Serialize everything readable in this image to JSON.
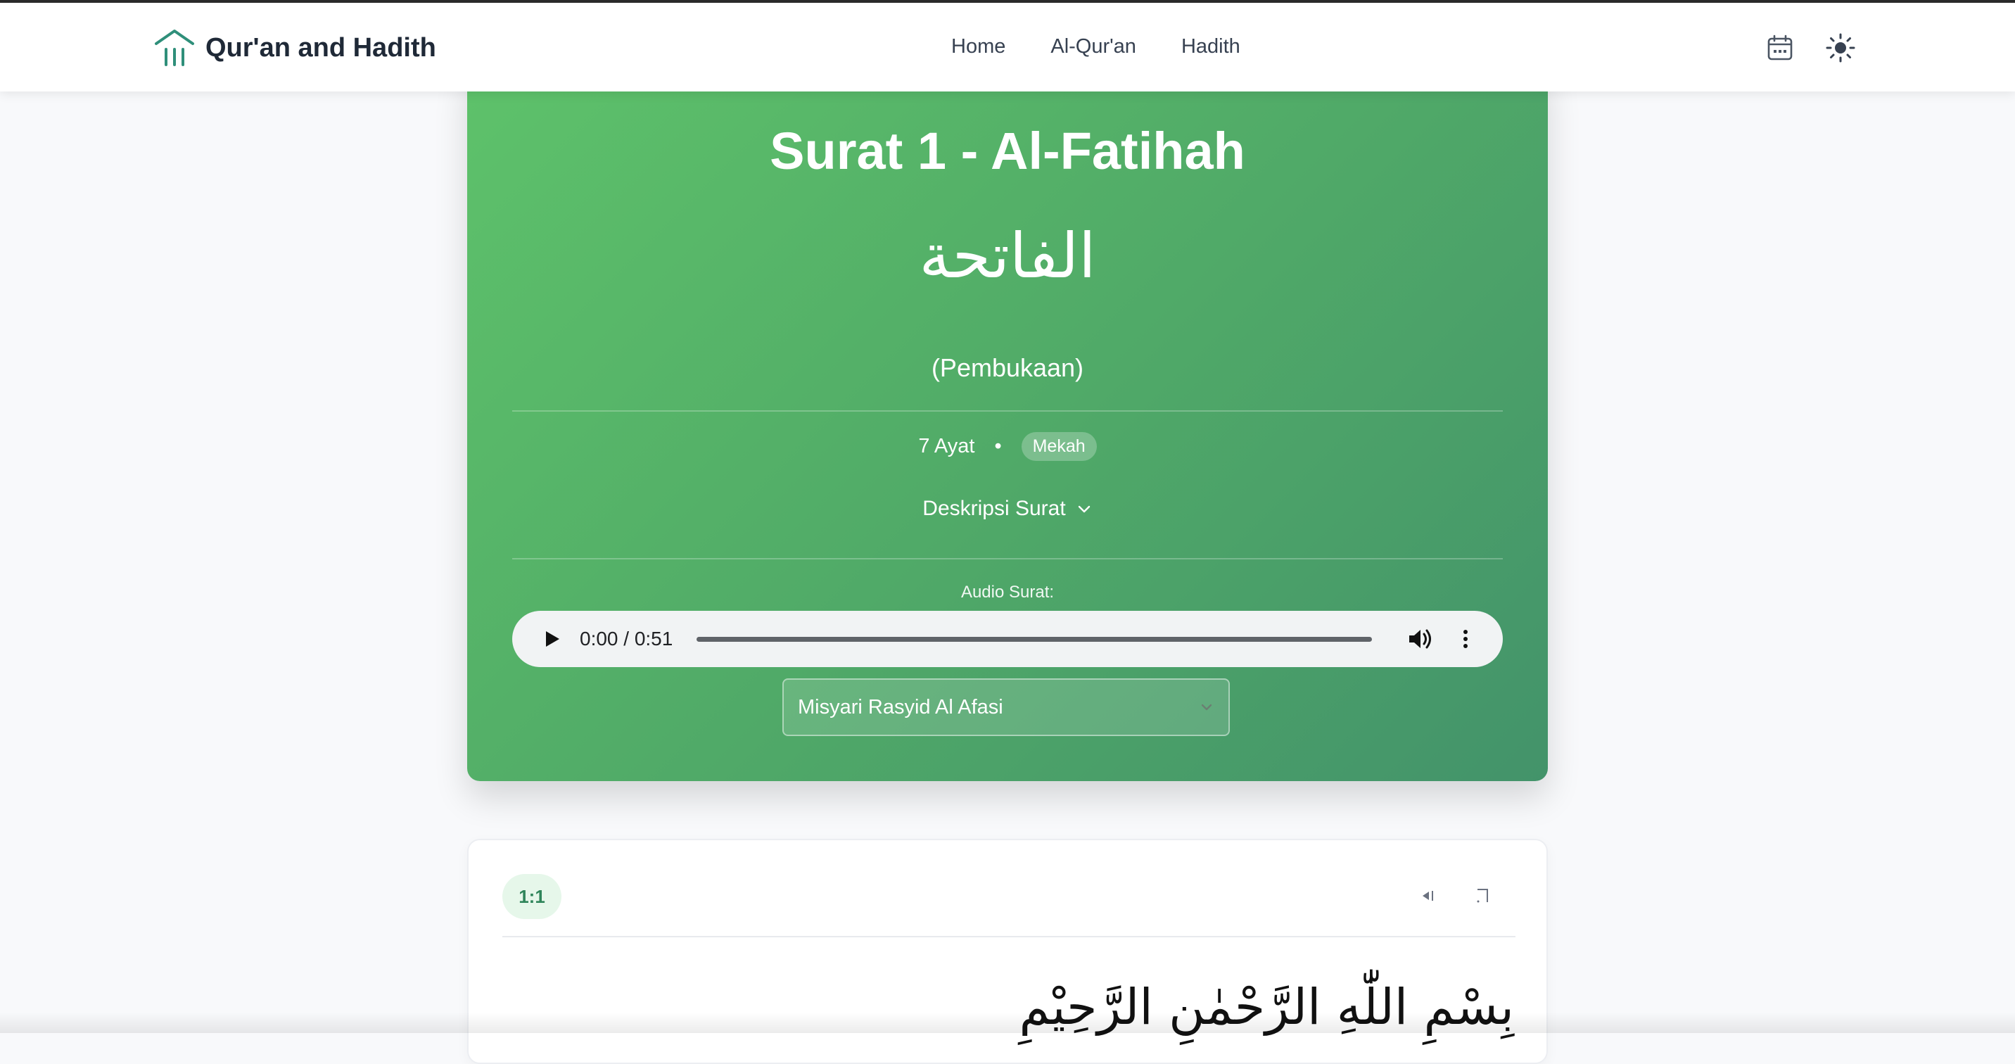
{
  "app": {
    "title": "Qur'an and Hadith"
  },
  "nav": {
    "items": [
      {
        "label": "Home"
      },
      {
        "label": "Al-Qur'an"
      },
      {
        "label": "Hadith"
      }
    ],
    "icons": [
      "calendar-icon",
      "sun-icon"
    ]
  },
  "surah": {
    "title": "Surat 1 - Al-Fatihah",
    "arabic_name": "الفاتحة",
    "meaning": "(Pembukaan)",
    "ayat_count": "7 Ayat",
    "separator": "•",
    "revelation": "Mekah",
    "description_toggle": "Deskripsi Surat",
    "audio_label": "Audio Surat:",
    "audio_time": "0:00 / 0:51",
    "reciter": "Misyari Rasyid Al Afasi"
  },
  "verse": {
    "number": "1:1",
    "arabic": "بِسْمِ اللّٰهِ الرَّحْمٰنِ الرَّحِيْمِ",
    "actions": [
      "play-icon",
      "bookmark-icon"
    ]
  },
  "colors": {
    "accent_green": "#5ec26a",
    "accent_green_dark": "#43936a",
    "logo_teal": "#2f8f7a",
    "badge_green_bg": "#e6f7ea"
  }
}
